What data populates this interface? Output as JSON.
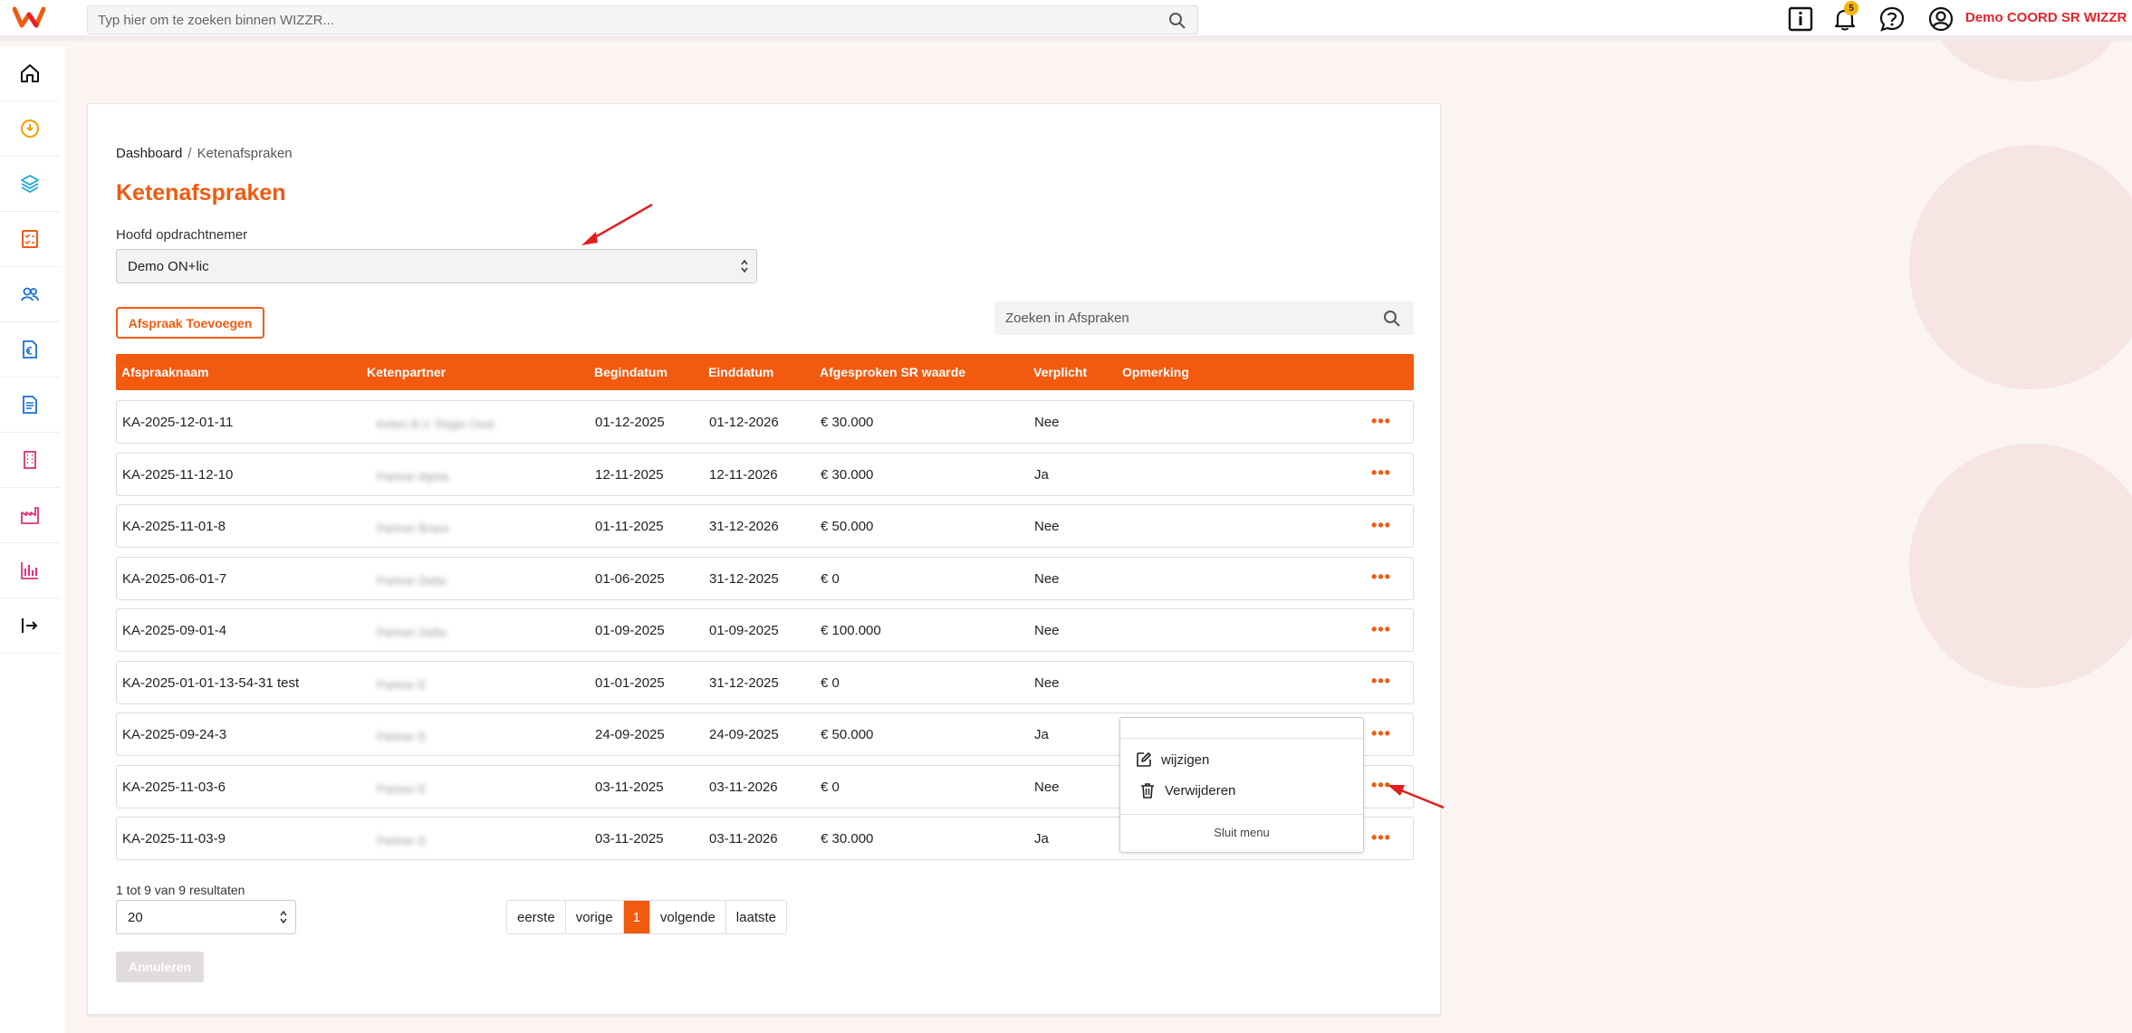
{
  "header": {
    "search_placeholder": "Typ hier om te zoeken binnen WIZZR...",
    "notification_count": "5",
    "user_name": "Demo COORD SR WIZZR",
    "icons": [
      "info-icon",
      "bell-icon",
      "help-icon",
      "user-icon"
    ]
  },
  "sidebar": {
    "items": [
      "home-icon",
      "dashboard-gauge-icon",
      "layers-icon",
      "checklist-icon",
      "users-icon",
      "euro-document-icon",
      "document-icon",
      "building-icon",
      "factory-icon",
      "bar-chart-icon",
      "logout-icon"
    ]
  },
  "breadcrumb": {
    "home": "Dashboard",
    "separator": "/",
    "current": "Ketenafspraken"
  },
  "page": {
    "title": "Ketenafspraken",
    "contractor_label": "Hoofd opdrachtnemer",
    "contractor_value": "Demo ON+lic",
    "add_button": "Afspraak Toevoegen",
    "table_search_placeholder": "Zoeken in Afspraken"
  },
  "table": {
    "headers": [
      "Afspraaknaam",
      "Ketenpartner",
      "Begindatum",
      "Einddatum",
      "Afgesproken SR waarde",
      "Verplicht",
      "Opmerking"
    ],
    "rows": [
      {
        "name": "KA-2025-12-01-11",
        "partner": "Keten B.V. Regio Oost",
        "start": "01-12-2025",
        "end": "01-12-2026",
        "value": "€ 30.000",
        "mandatory": "Nee",
        "remark": ""
      },
      {
        "name": "KA-2025-11-12-10",
        "partner": "Partner Alpha",
        "start": "12-11-2025",
        "end": "12-11-2026",
        "value": "€ 30.000",
        "mandatory": "Ja",
        "remark": ""
      },
      {
        "name": "KA-2025-11-01-8",
        "partner": "Partner Bravo",
        "start": "01-11-2025",
        "end": "31-12-2026",
        "value": "€ 50.000",
        "mandatory": "Nee",
        "remark": ""
      },
      {
        "name": "KA-2025-06-01-7",
        "partner": "Partner Delta",
        "start": "01-06-2025",
        "end": "31-12-2025",
        "value": "€ 0",
        "mandatory": "Nee",
        "remark": ""
      },
      {
        "name": "KA-2025-09-01-4",
        "partner": "Partner Delta",
        "start": "01-09-2025",
        "end": "01-09-2025",
        "value": "€ 100.000",
        "mandatory": "Nee",
        "remark": ""
      },
      {
        "name": "KA-2025-01-01-13-54-31 test",
        "partner": "Partner E",
        "start": "01-01-2025",
        "end": "31-12-2025",
        "value": "€ 0",
        "mandatory": "Nee",
        "remark": ""
      },
      {
        "name": "KA-2025-09-24-3",
        "partner": "Partner E",
        "start": "24-09-2025",
        "end": "24-09-2025",
        "value": "€ 50.000",
        "mandatory": "Ja",
        "remark": ""
      },
      {
        "name": "KA-2025-11-03-6",
        "partner": "Partner E",
        "start": "03-11-2025",
        "end": "03-11-2026",
        "value": "€ 0",
        "mandatory": "Nee",
        "remark": ""
      },
      {
        "name": "KA-2025-11-03-9",
        "partner": "Partner E",
        "start": "03-11-2025",
        "end": "03-11-2026",
        "value": "€ 30.000",
        "mandatory": "Ja",
        "remark": ""
      }
    ],
    "row_menu_label": "•••"
  },
  "context_menu": {
    "edit": "wijzigen",
    "delete": "Verwijderen",
    "close": "Sluit menu"
  },
  "footer": {
    "results": "1 tot 9 van 9 resultaten",
    "page_size": "20",
    "pager": [
      "eerste",
      "vorige",
      "1",
      "volgende",
      "laatste"
    ],
    "cancel": "Annuleren"
  },
  "colors": {
    "accent": "#f15a0f",
    "user_name": "#e8212a",
    "annotation_arrow": "#e02020"
  }
}
